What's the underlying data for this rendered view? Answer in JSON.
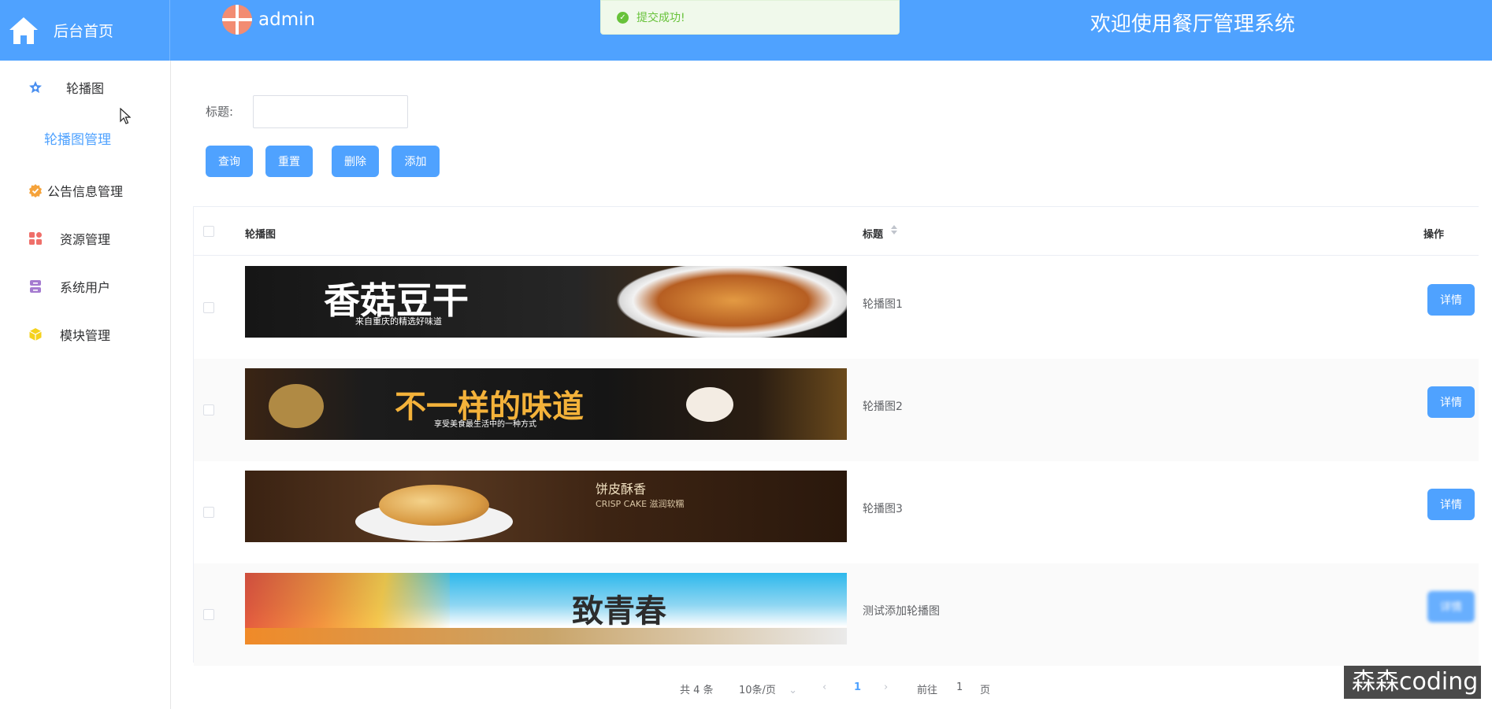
{
  "header": {
    "home_label": "后台首页",
    "user_name": "admin",
    "welcome": "欢迎使用餐厅管理系统",
    "bg_color": "#4fa2ff"
  },
  "toast": {
    "text": "提交成功!",
    "icon": "check-circle-icon"
  },
  "sidebar": {
    "items": [
      {
        "label": "轮播图",
        "icon": "star-icon",
        "icon_color": "#4a8ff0"
      },
      {
        "label": "公告信息管理",
        "icon": "badge-icon",
        "icon_color": "#f5a33b"
      },
      {
        "label": "资源管理",
        "icon": "apps-grid-icon",
        "icon_color": "#ef6f6a"
      },
      {
        "label": "系统用户",
        "icon": "user-card-icon",
        "icon_color": "#a57bd0"
      },
      {
        "label": "模块管理",
        "icon": "cube-icon",
        "icon_color": "#f5d21c"
      }
    ],
    "submenu": {
      "label": "轮播图管理"
    }
  },
  "search": {
    "label": "标题:",
    "value": "",
    "placeholder": ""
  },
  "actions": {
    "query": "查询",
    "reset": "重置",
    "delete": "删除",
    "add": "添加"
  },
  "table": {
    "columns": [
      "轮播图",
      "标题",
      "操作"
    ],
    "rows": [
      {
        "title": "轮播图1",
        "banner_text": "香菇豆干",
        "banner_sub": "来自重庆的精选好味道",
        "action": "详情"
      },
      {
        "title": "轮播图2",
        "banner_text": "不一样的味道",
        "banner_sub": "享受美食最生活中的一种方式",
        "action": "详情"
      },
      {
        "title": "轮播图3",
        "banner_text": "饼皮酥香",
        "banner_sub": "CRISP CAKE 滋润软糯",
        "action": "详情"
      },
      {
        "title": "测试添加轮播图",
        "banner_text": "致青春",
        "banner_sub": "",
        "action": "详情"
      }
    ]
  },
  "pagination": {
    "total": "共 4 条",
    "page_size": "10条/页",
    "current": "1",
    "goto_prefix": "前往",
    "goto_value": "1",
    "goto_suffix": "页"
  },
  "watermark": "森森coding"
}
